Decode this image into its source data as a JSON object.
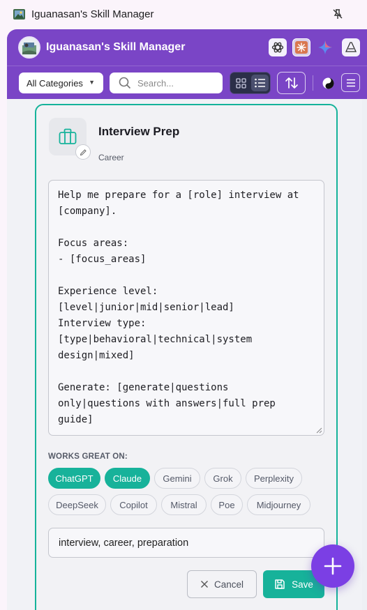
{
  "window": {
    "title": "Iguanasan's Skill Manager"
  },
  "header": {
    "app_name": "Iguanasan's Skill Manager",
    "ai_buttons": [
      "openai-icon",
      "claude-icon",
      "gemini-icon",
      "other-icon"
    ]
  },
  "toolbar": {
    "category_select": "All Categories",
    "search_placeholder": "Search...",
    "view_mode": "list"
  },
  "skill": {
    "title": "Interview Prep",
    "category": "Career",
    "prompt": "Help me prepare for a [role] interview at\n[company].\n\nFocus areas:\n- [focus_areas]\n\nExperience level:\n[level|junior|mid|senior|lead]\nInterview type:\n[type|behavioral|technical|system\ndesign|mixed]\n\nGenerate: [generate|questions\nonly|questions with answers|full prep\nguide]",
    "works_label": "WORKS GREAT ON:",
    "platforms": [
      {
        "label": "ChatGPT",
        "active": true
      },
      {
        "label": "Claude",
        "active": true
      },
      {
        "label": "Gemini",
        "active": false
      },
      {
        "label": "Grok",
        "active": false
      },
      {
        "label": "Perplexity",
        "active": false
      },
      {
        "label": "DeepSeek",
        "active": false
      },
      {
        "label": "Copilot",
        "active": false
      },
      {
        "label": "Mistral",
        "active": false
      },
      {
        "label": "Poe",
        "active": false
      },
      {
        "label": "Midjourney",
        "active": false
      }
    ],
    "tags": "interview, career, preparation",
    "cancel_label": "Cancel",
    "save_label": "Save"
  },
  "colors": {
    "brand": "#7a45c6",
    "accent": "#17b29a",
    "fab": "#7b3fe4"
  }
}
